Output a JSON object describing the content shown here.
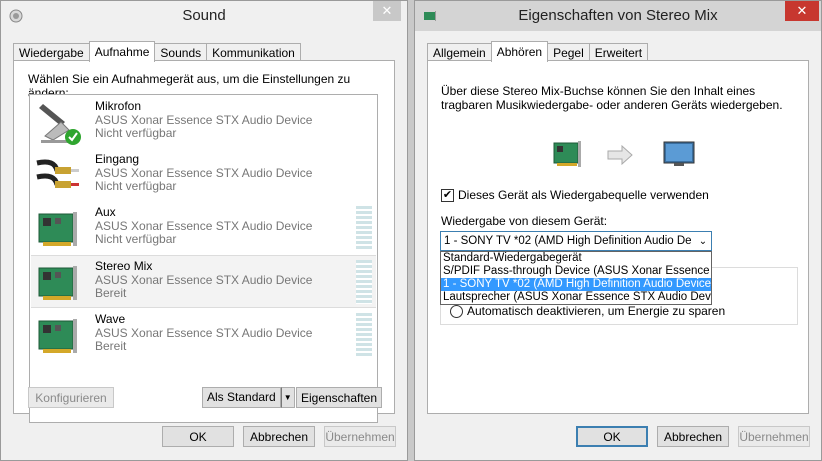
{
  "sound": {
    "title": "Sound",
    "close": "✕",
    "tabs": [
      "Wiedergabe",
      "Aufnahme",
      "Sounds",
      "Kommunikation"
    ],
    "active_tab": 1,
    "instructions": "Wählen Sie ein Aufnahmegerät aus, um die Einstellungen zu ändern:",
    "devices": [
      {
        "name": "Mikrofon",
        "desc": "ASUS Xonar Essence STX Audio Device",
        "status": "Nicht verfügbar",
        "icon": "microphone-icon"
      },
      {
        "name": "Eingang",
        "desc": "ASUS Xonar Essence STX Audio Device",
        "status": "Nicht verfügbar",
        "icon": "rca-cable-icon"
      },
      {
        "name": "Aux",
        "desc": "ASUS Xonar Essence STX Audio Device",
        "status": "Nicht verfügbar",
        "icon": "sound-card-icon"
      },
      {
        "name": "Stereo Mix",
        "desc": "ASUS Xonar Essence STX Audio Device",
        "status": "Bereit",
        "icon": "sound-card-icon"
      },
      {
        "name": "Wave",
        "desc": "ASUS Xonar Essence STX Audio Device",
        "status": "Bereit",
        "icon": "sound-card-icon"
      }
    ],
    "buttons": {
      "configure": "Konfigurieren",
      "set_default": "Als Standard",
      "properties": "Eigenschaften",
      "ok": "OK",
      "cancel": "Abbrechen",
      "apply": "Übernehmen"
    }
  },
  "props": {
    "title": "Eigenschaften von Stereo Mix",
    "close": "✕",
    "tabs": [
      "Allgemein",
      "Abhören",
      "Pegel",
      "Erweitert"
    ],
    "active_tab": 1,
    "description": "Über diese Stereo Mix-Buchse können Sie den Inhalt eines tragbaren Musikwiedergabe- oder anderen Geräts wiedergeben.",
    "listen_checkbox": "Dieses Gerät als Wiedergabequelle verwenden",
    "listen_checked": true,
    "playback_label": "Wiedergabe von diesem Gerät:",
    "combo_value": "1 - SONY TV  *02 (AMD High Definition Audio De",
    "dropdown_options": [
      "Standard-Wiedergabegerät",
      "S/PDIF Pass-through Device (ASUS Xonar Essence STX",
      "1 - SONY TV  *02 (AMD High Definition Audio Device",
      "Lautsprecher (ASUS Xonar Essence STX Audio Device"
    ],
    "dropdown_selected": 2,
    "radio_label": "Automatisch deaktivieren, um Energie zu sparen",
    "buttons": {
      "ok": "OK",
      "cancel": "Abbrechen",
      "apply": "Übernehmen"
    }
  }
}
